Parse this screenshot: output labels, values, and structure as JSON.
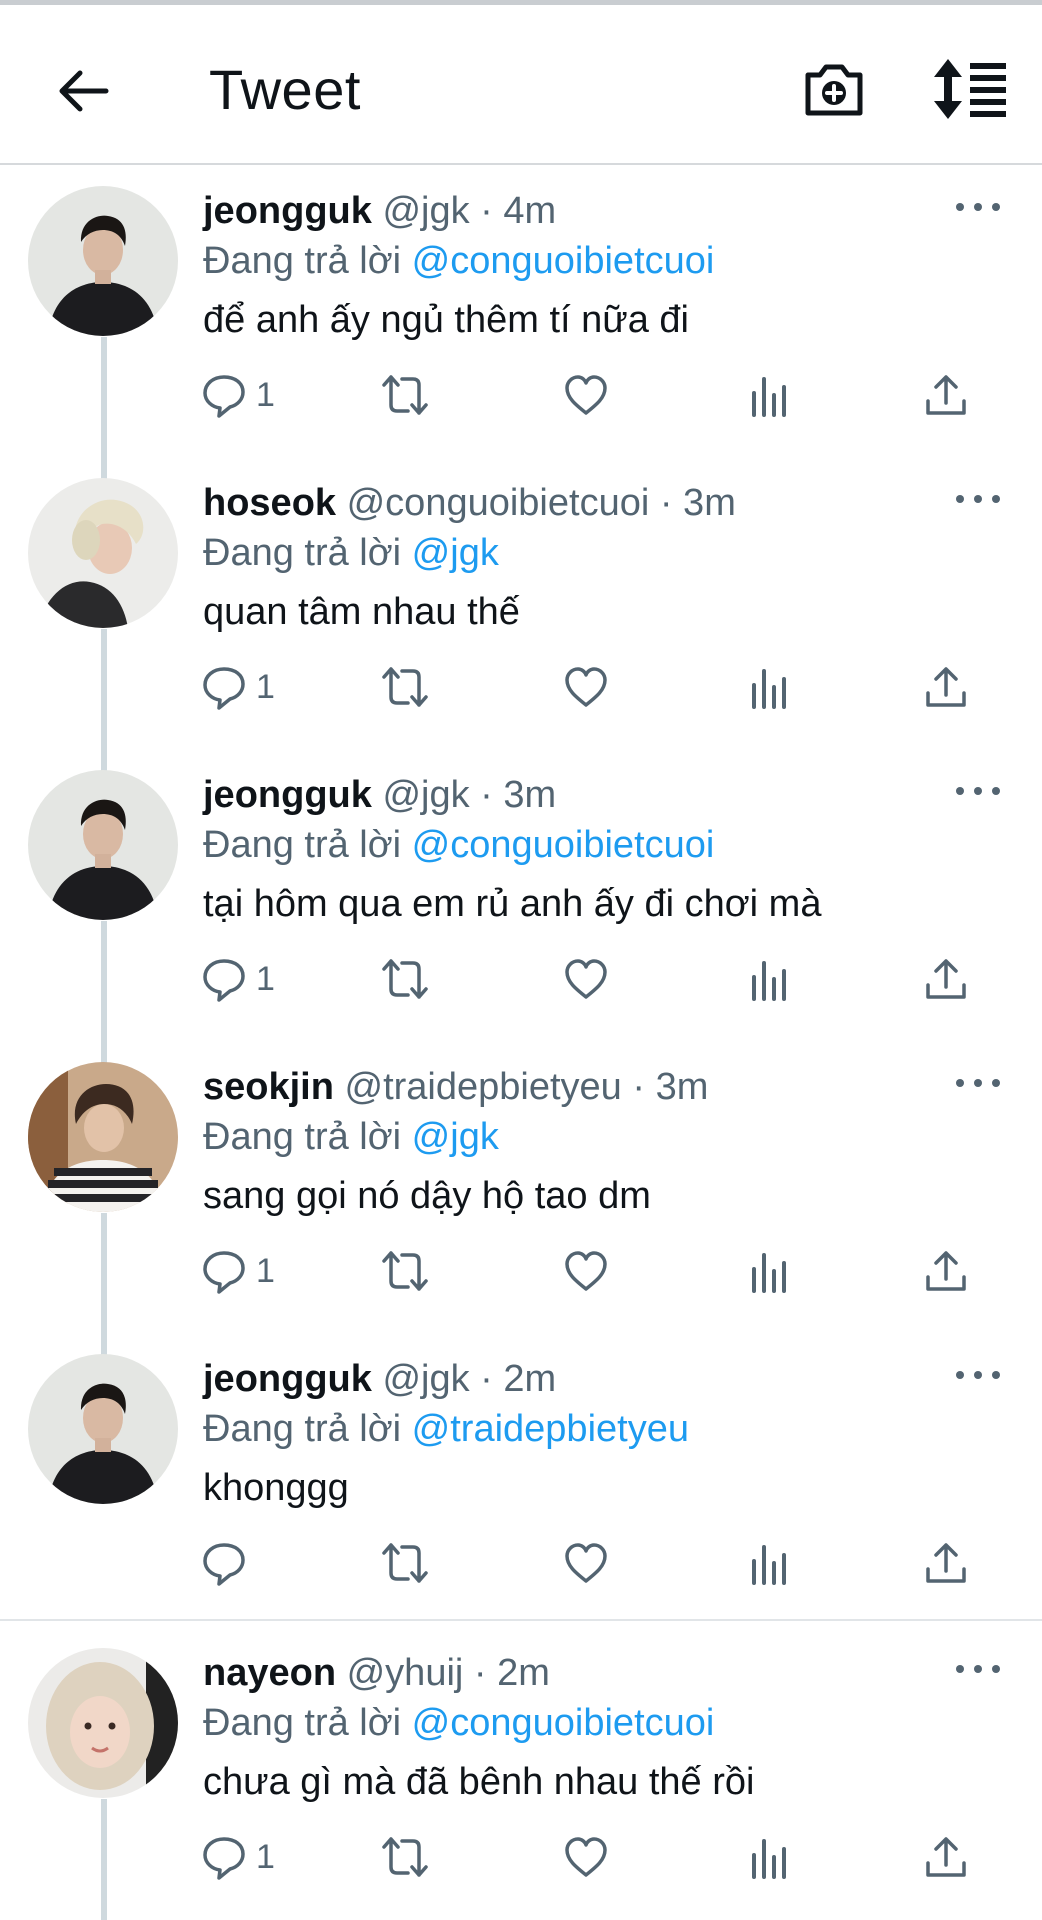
{
  "header": {
    "title": "Tweet",
    "icons": {
      "back": "arrow-left-icon",
      "camera": "camera-plus-icon",
      "sort": "sort-replies-icon"
    }
  },
  "colors": {
    "accent": "#1d9bf0",
    "secondary_text": "#536471",
    "primary_text": "#0f1419",
    "thread_line": "#cfd9de"
  },
  "replying_prefix": "Đang trả lời",
  "tweets": [
    {
      "name": "jeongguk",
      "handle": "@jgk",
      "time": "· 4m",
      "reply_to": "@conguoibietcuoi",
      "text": "để anh ấy ngủ thêm tí nữa đi",
      "reply_count": "1",
      "avatar": "avatar-jeongguk"
    },
    {
      "name": "hoseok",
      "handle": "@conguoibietcuoi",
      "time": "· 3m",
      "reply_to": "@jgk",
      "text": "quan tâm nhau thế",
      "reply_count": "1",
      "avatar": "avatar-hoseok"
    },
    {
      "name": "jeongguk",
      "handle": "@jgk",
      "time": "· 3m",
      "reply_to": "@conguoibietcuoi",
      "text": "tại hôm qua em rủ anh ấy đi chơi mà",
      "reply_count": "1",
      "avatar": "avatar-jeongguk"
    },
    {
      "name": "seokjin",
      "handle": "@traidepbietyeu",
      "time": "· 3m",
      "reply_to": "@jgk",
      "text": "sang gọi nó dậy hộ tao dm",
      "reply_count": "1",
      "avatar": "avatar-seokjin"
    },
    {
      "name": "jeongguk",
      "handle": "@jgk",
      "time": "· 2m",
      "reply_to": "@traidepbietyeu",
      "text": "khonggg",
      "reply_count": "",
      "avatar": "avatar-jeongguk"
    },
    {
      "name": "nayeon",
      "handle": "@yhuij",
      "time": "· 2m",
      "reply_to": "@conguoibietcuoi",
      "text": "chưa gì mà đã bênh nhau thế rồi",
      "reply_count": "1",
      "avatar": "avatar-nayeon"
    }
  ]
}
